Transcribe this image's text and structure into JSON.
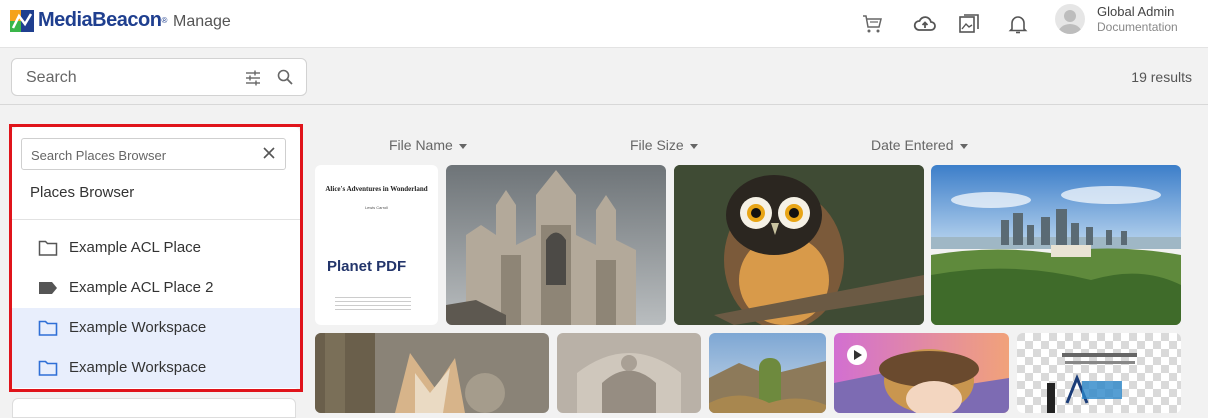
{
  "header": {
    "logo_text": "MediaBeacon",
    "logo_mark": "®",
    "section": "Manage",
    "icons": [
      "cart-icon",
      "cloud-upload-icon",
      "gallery-icon",
      "bell-icon"
    ],
    "user_name": "Global Admin",
    "user_role": "Documentation"
  },
  "search": {
    "placeholder": "Search",
    "icons": [
      "filter-sliders-icon",
      "search-icon"
    ]
  },
  "results": "19 results",
  "places": {
    "search_placeholder": "Search Places Browser",
    "title": "Places Browser",
    "items": [
      {
        "label": "Example ACL Place",
        "icon": "folder-outline-icon",
        "selected": false
      },
      {
        "label": "Example ACL Place 2",
        "icon": "tag-icon",
        "selected": false
      },
      {
        "label": "Example Workspace",
        "icon": "folder-blue-icon",
        "selected": true
      },
      {
        "label": "Example Workspace",
        "icon": "folder-blue-icon",
        "selected": true
      }
    ]
  },
  "sort": {
    "file_name": "File Name",
    "file_size": "File Size",
    "date_entered": "Date Entered"
  },
  "thumbnails": {
    "pdf_title": "Alice's Adventures in Wonderland",
    "pdf_author": "Lewis Carroll",
    "pdf_logo": "Planet PDF",
    "items": [
      "pdf-document",
      "cathedral-photo",
      "owl-photo",
      "city-skyline-photo",
      "fennec-fox-photo",
      "stone-carving-photo",
      "cactus-photo",
      "animated-character-video",
      "transparent-logo-image"
    ]
  },
  "colors": {
    "brand": "#1f3f8f",
    "highlight_frame": "#e0141b",
    "selected_row": "#e8eefc",
    "folder_blue": "#2f6fd6"
  }
}
